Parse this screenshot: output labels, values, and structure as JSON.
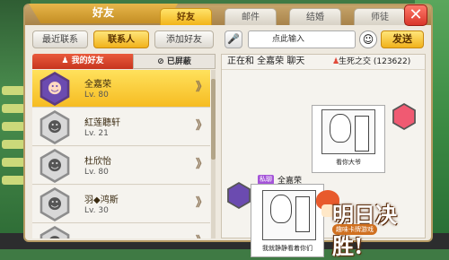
{
  "window": {
    "ribbon_title": "好友",
    "tabs": [
      {
        "label": "好友",
        "active": true
      },
      {
        "label": "邮件",
        "active": false
      },
      {
        "label": "结婚",
        "active": false
      },
      {
        "label": "师徒",
        "active": false
      }
    ],
    "close_glyph": "✕"
  },
  "left": {
    "buttons": {
      "recent": "最近联系",
      "contacts": "联系人",
      "add": "添加好友"
    },
    "subtabs": {
      "my_friends": "我的好友",
      "blocked": "已屏蔽"
    },
    "friends": [
      {
        "name": "全嘉荣",
        "level": "Lv. 80",
        "selected": true
      },
      {
        "name": "紅莲聽轩",
        "level": "Lv. 21",
        "selected": false
      },
      {
        "name": "杜欣怡",
        "level": "Lv. 80",
        "selected": false
      },
      {
        "name": "羽◆鸿斯",
        "level": "Lv. 30",
        "selected": false
      },
      {
        "name": "",
        "level": "",
        "selected": false
      }
    ],
    "chevron": "》"
  },
  "right": {
    "input_placeholder": "点此输入",
    "send_label": "发送",
    "chat_title": "正在和 全嘉荣 聊天",
    "group_name": "生死之交 (123622)",
    "messages": [
      {
        "from": "self",
        "caption": "看你大爷"
      },
      {
        "from": "peer",
        "tag": "私聊",
        "name": "全嘉荣",
        "caption": "我就静静看着你们"
      }
    ]
  },
  "logo": {
    "title": "明日决胜!",
    "subtitle": "趣味卡牌游戏"
  },
  "colors": {
    "accent_gold": "#f1b21b",
    "tab_red": "#c7351e",
    "close_red": "#d9362a",
    "private_tag": "#a454d8"
  }
}
